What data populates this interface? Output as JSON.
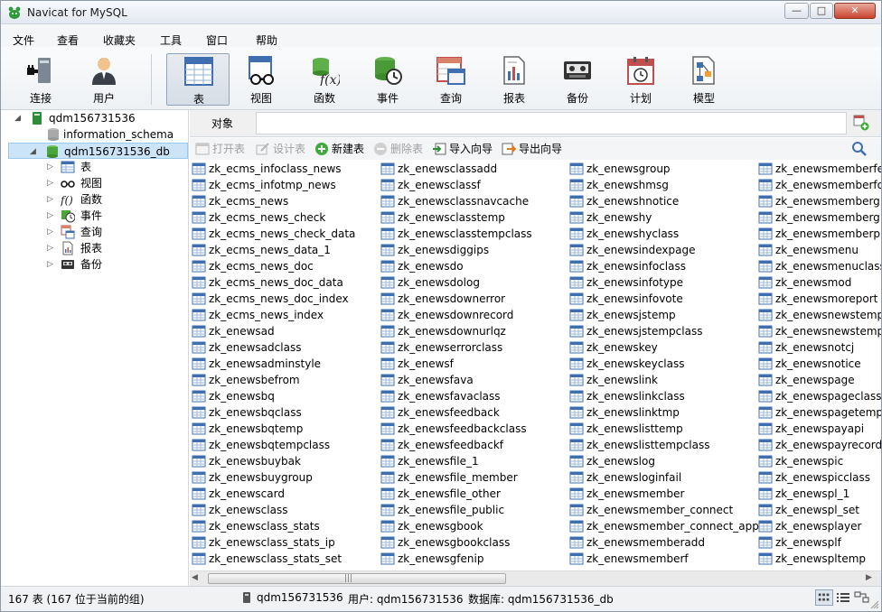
{
  "window": {
    "title": "Navicat for MySQL",
    "minimize": "—",
    "maximize": "□",
    "close": "✕"
  },
  "menu": [
    "文件",
    "查看",
    "收藏夹",
    "工具",
    "窗口",
    "帮助"
  ],
  "toolbar": [
    {
      "label": "连接",
      "icon": "connection-plug-icon"
    },
    {
      "label": "用户",
      "icon": "user-icon"
    },
    {
      "label": "表",
      "icon": "table-icon",
      "active": true
    },
    {
      "label": "视图",
      "icon": "view-icon"
    },
    {
      "label": "函数",
      "icon": "function-icon"
    },
    {
      "label": "事件",
      "icon": "event-icon"
    },
    {
      "label": "查询",
      "icon": "query-icon"
    },
    {
      "label": "报表",
      "icon": "report-icon"
    },
    {
      "label": "备份",
      "icon": "backup-icon"
    },
    {
      "label": "计划",
      "icon": "schedule-icon"
    },
    {
      "label": "模型",
      "icon": "model-icon"
    }
  ],
  "tree": {
    "connection": "qdm156731536",
    "db_info": "information_schema",
    "db_selected": "qdm156731536_db",
    "children": [
      "表",
      "视图",
      "函数",
      "事件",
      "查询",
      "报表",
      "备份"
    ]
  },
  "object_tab": {
    "label": "对象",
    "value": ""
  },
  "actions": [
    {
      "label": "打开表",
      "disabled": true
    },
    {
      "label": "设计表",
      "disabled": true
    },
    {
      "label": "新建表",
      "disabled": false
    },
    {
      "label": "删除表",
      "disabled": true
    },
    {
      "label": "导入向导",
      "disabled": false
    },
    {
      "label": "导出向导",
      "disabled": false
    }
  ],
  "tables": {
    "col1": [
      "zk_ecms_infoclass_news",
      "zk_ecms_infotmp_news",
      "zk_ecms_news",
      "zk_ecms_news_check",
      "zk_ecms_news_check_data",
      "zk_ecms_news_data_1",
      "zk_ecms_news_doc",
      "zk_ecms_news_doc_data",
      "zk_ecms_news_doc_index",
      "zk_ecms_news_index",
      "zk_enewsad",
      "zk_enewsadclass",
      "zk_enewsadminstyle",
      "zk_enewsbefrom",
      "zk_enewsbq",
      "zk_enewsbqclass",
      "zk_enewsbqtemp",
      "zk_enewsbqtempclass",
      "zk_enewsbuybak",
      "zk_enewsbuygroup",
      "zk_enewscard",
      "zk_enewsclass",
      "zk_enewsclass_stats",
      "zk_enewsclass_stats_ip",
      "zk_enewsclass_stats_set"
    ],
    "col2": [
      "zk_enewsclassadd",
      "zk_enewsclassf",
      "zk_enewsclassnavcache",
      "zk_enewsclasstemp",
      "zk_enewsclasstempclass",
      "zk_enewsdiggips",
      "zk_enewsdo",
      "zk_enewsdolog",
      "zk_enewsdownerror",
      "zk_enewsdownrecord",
      "zk_enewsdownurlqz",
      "zk_enewserrorclass",
      "zk_enewsf",
      "zk_enewsfava",
      "zk_enewsfavaclass",
      "zk_enewsfeedback",
      "zk_enewsfeedbackclass",
      "zk_enewsfeedbackf",
      "zk_enewsfile_1",
      "zk_enewsfile_member",
      "zk_enewsfile_other",
      "zk_enewsfile_public",
      "zk_enewsgbook",
      "zk_enewsgbookclass",
      "zk_enewsgfenip"
    ],
    "col3": [
      "zk_enewsgroup",
      "zk_enewshmsg",
      "zk_enewshnotice",
      "zk_enewshy",
      "zk_enewshyclass",
      "zk_enewsindexpage",
      "zk_enewsinfoclass",
      "zk_enewsinfotype",
      "zk_enewsinfovote",
      "zk_enewsjstemp",
      "zk_enewsjstempclass",
      "zk_enewskey",
      "zk_enewskeyclass",
      "zk_enewslink",
      "zk_enewslinkclass",
      "zk_enewslinktmp",
      "zk_enewslisttemp",
      "zk_enewslisttempclass",
      "zk_enewslog",
      "zk_enewsloginfail",
      "zk_enewsmember",
      "zk_enewsmember_connect",
      "zk_enewsmember_connect_app",
      "zk_enewsmemberadd",
      "zk_enewsmemberf"
    ],
    "col4": [
      "zk_enewsmemberfe",
      "zk_enewsmemberfo",
      "zk_enewsmemberg",
      "zk_enewsmemberg",
      "zk_enewsmemberp",
      "zk_enewsmenu",
      "zk_enewsmenuclass",
      "zk_enewsmod",
      "zk_enewsmoreport",
      "zk_enewsnewstemp",
      "zk_enewsnewstemp",
      "zk_enewsnotcj",
      "zk_enewsnotice",
      "zk_enewspage",
      "zk_enewspageclass",
      "zk_enewspagetemp",
      "zk_enewspayapi",
      "zk_enewspayrecord",
      "zk_enewspic",
      "zk_enewspicclass",
      "zk_enewspl_1",
      "zk_enewspl_set",
      "zk_enewsplayer",
      "zk_enewsplf",
      "zk_enewspltemp"
    ]
  },
  "status": {
    "count": "167 表 (167 位于当前的组)",
    "connection": "qdm156731536",
    "user": "用户: qdm156731536",
    "database": "数据库: qdm156731536_db"
  },
  "colors": {
    "accent": "#cce4f7",
    "toolbar_bg": "#eef1f4",
    "table_icon": "#3f6fb0"
  }
}
